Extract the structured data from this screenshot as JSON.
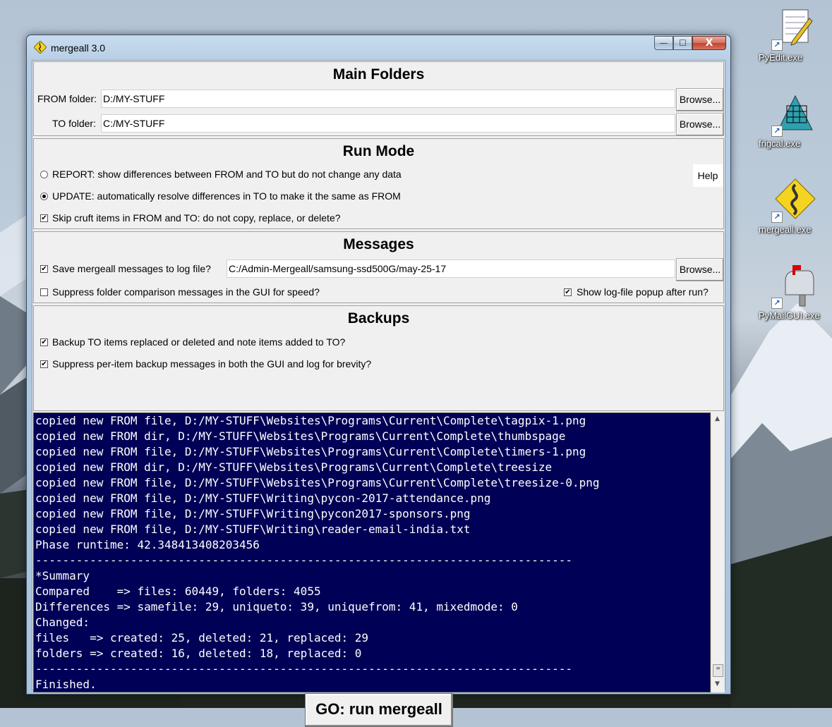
{
  "desktop": {
    "icons": [
      {
        "label": "PyEdit.exe"
      },
      {
        "label": "frigcal.exe"
      },
      {
        "label": "mergeall.exe"
      },
      {
        "label": "PyMailGUI.exe"
      }
    ]
  },
  "window": {
    "title": "mergeall 3.0",
    "buttons": {
      "minimize": "—",
      "maximize": "☐",
      "close": "X"
    }
  },
  "main_folders": {
    "title": "Main Folders",
    "from_label": "FROM folder:",
    "from_value": "D:/MY-STUFF",
    "to_label": "TO folder:",
    "to_value": "C:/MY-STUFF",
    "browse_label": "Browse..."
  },
  "run_mode": {
    "title": "Run Mode",
    "report_label": "REPORT: show differences between FROM and TO but do not change any data",
    "update_label": "UPDATE: automatically resolve differences in TO to make it the same as FROM",
    "selected": "update",
    "skip_cruft_label": "Skip cruft items in FROM and TO: do not copy, replace, or delete?",
    "skip_cruft_checked": true,
    "help_label": "Help"
  },
  "messages": {
    "title": "Messages",
    "save_log_label": "Save mergeall messages to log file?",
    "save_log_checked": true,
    "log_path": "C:/Admin-Mergeall/samsung-ssd500G/may-25-17",
    "browse_label": "Browse...",
    "suppress_label": "Suppress folder comparison messages in the GUI for speed?",
    "suppress_checked": false,
    "popup_label": "Show log-file popup after run?",
    "popup_checked": true
  },
  "backups": {
    "title": "Backups",
    "backup_label": "Backup TO items replaced or deleted and note items added to TO?",
    "backup_checked": true,
    "suppress_label": "Suppress per-item backup messages in both the GUI and log for brevity?",
    "suppress_checked": true
  },
  "log": {
    "lines": [
      "copied new FROM file, D:/MY-STUFF\\Websites\\Programs\\Current\\Complete\\tagpix-1.png",
      "copied new FROM dir, D:/MY-STUFF\\Websites\\Programs\\Current\\Complete\\thumbspage",
      "copied new FROM file, D:/MY-STUFF\\Websites\\Programs\\Current\\Complete\\timers-1.png",
      "copied new FROM dir, D:/MY-STUFF\\Websites\\Programs\\Current\\Complete\\treesize",
      "copied new FROM file, D:/MY-STUFF\\Websites\\Programs\\Current\\Complete\\treesize-0.png",
      "copied new FROM file, D:/MY-STUFF\\Writing\\pycon-2017-attendance.png",
      "copied new FROM file, D:/MY-STUFF\\Writing\\pycon2017-sponsors.png",
      "copied new FROM file, D:/MY-STUFF\\Writing\\reader-email-india.txt",
      "Phase runtime: 42.348413408203456",
      "-------------------------------------------------------------------------------",
      "*Summary",
      "Compared    => files: 60449, folders: 4055",
      "Differences => samefile: 29, uniqueto: 39, uniquefrom: 41, mixedmode: 0",
      "Changed:",
      "files   => created: 25, deleted: 21, replaced: 29",
      "folders => created: 16, deleted: 18, replaced: 0",
      "-------------------------------------------------------------------------------",
      "Finished."
    ]
  },
  "go_button": "GO: run mergeall"
}
